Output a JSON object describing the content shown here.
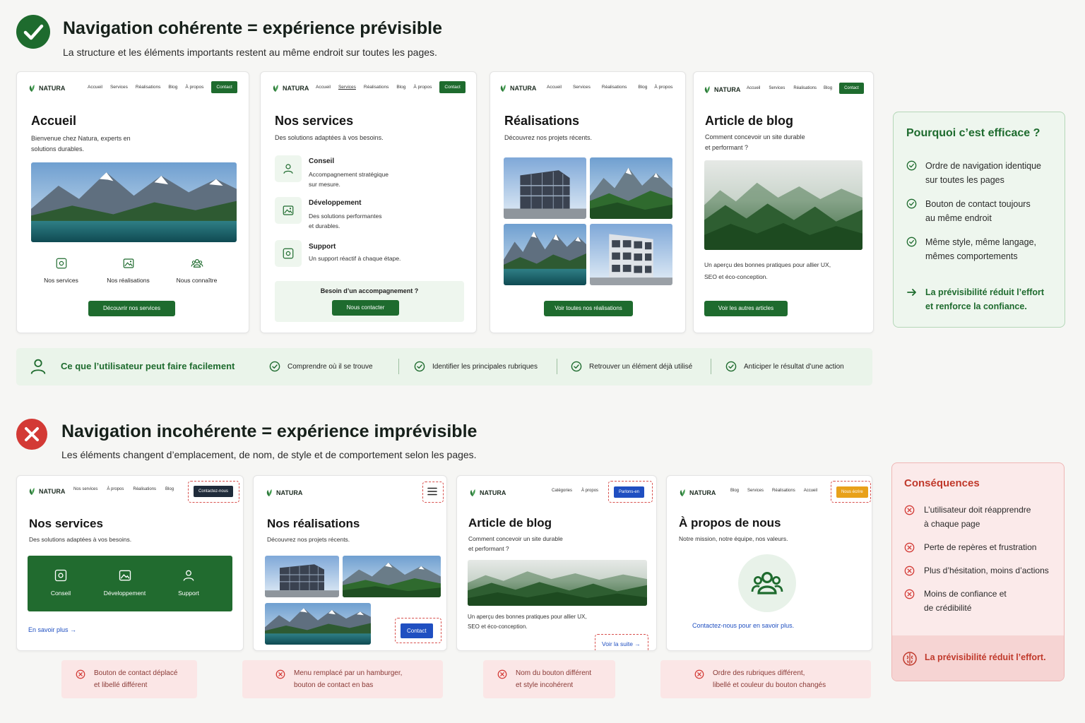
{
  "colors": {
    "green": "#1e6b2e",
    "red": "#d33a35",
    "panel_green": "#eef6ee",
    "panel_red": "#fbe9e9",
    "blue": "#1f4fc1",
    "orange": "#e8a11a",
    "navy": "#1f2b3a"
  },
  "good": {
    "title": "Navigation cohérente = expérience prévisible",
    "subtitle": "La structure et les éléments importants restent au même endroit sur toutes les pages.",
    "cards": [
      {
        "logo": "NATURA",
        "nav": [
          "Accueil",
          "Services",
          "Réalisations",
          "Blog",
          "À propos"
        ],
        "contact": "Contact",
        "heading": "Accueil",
        "desc": [
          "Bienvenue chez Natura, experts en",
          "solutions durables."
        ],
        "icons": [
          {
            "icon": "services-icon",
            "label": "Nos services"
          },
          {
            "icon": "projects-icon",
            "label": "Nos réalisations"
          },
          {
            "icon": "team-icon",
            "label": "Nous connaître"
          }
        ],
        "cta": "Découvrir nos services"
      },
      {
        "logo": "NATURA",
        "nav": [
          "Accueil",
          "Services",
          "Réalisations",
          "Blog",
          "À propos"
        ],
        "contact": "Contact",
        "heading": "Nos services",
        "desc": [
          "Des solutions adaptées à vos besoins."
        ],
        "services": [
          {
            "icon": "advice-icon",
            "title": "Conseil",
            "desc": [
              "Accompagnement stratégique",
              "sur mesure."
            ]
          },
          {
            "icon": "development-icon",
            "title": "Développement",
            "desc": [
              "Des solutions performantes",
              "et durables."
            ]
          },
          {
            "icon": "support-icon",
            "title": "Support",
            "desc": [
              "Un support réactif à chaque étape."
            ]
          }
        ],
        "box_title": "Besoin d’un accompagnement ?",
        "cta": "Nous contacter"
      },
      {
        "logo": "NATURA",
        "nav": [
          "Accueil",
          "Services",
          "Réalisations",
          "Blog",
          "À propos"
        ],
        "heading": "Réalisations",
        "desc": [
          "Découvrez nos projets récents."
        ],
        "cta": "Voir toutes nos réalisations"
      },
      {
        "logo": "NATURA",
        "nav": [
          "Accueil",
          "Services",
          "Réalisations",
          "Blog"
        ],
        "contact": "Contact",
        "heading": "Article de blog",
        "desc": [
          "Comment concevoir un site durable",
          "et performant ?"
        ],
        "excerpt": [
          "Un aperçu des bonnes pratiques pour allier UX,",
          "SEO et éco-conception."
        ],
        "cta": "Voir les autres articles"
      }
    ],
    "why": {
      "title": "Pourquoi c’est efficace ?",
      "items": [
        [
          "Ordre de navigation identique",
          "sur toutes les pages"
        ],
        [
          "Bouton de contact toujours",
          "au même endroit"
        ],
        [
          "Même style, même langage,",
          "mêmes comportements"
        ]
      ],
      "conclusion": [
        "La prévisibilité réduit l’effort",
        "et renforce la confiance."
      ]
    },
    "bar": {
      "title": "Ce que l’utilisateur peut faire facilement",
      "items": [
        "Comprendre où il se trouve",
        "Identifier les principales rubriques",
        "Retrouver un élément déjà utilisé",
        "Anticiper le résultat d’une action"
      ]
    }
  },
  "bad": {
    "title": "Navigation incohérente = expérience imprévisible",
    "subtitle": "Les éléments changent d’emplacement, de nom, de style et de comportement selon les pages.",
    "cards": [
      {
        "logo": "NATURA",
        "nav": [
          "Nos services",
          "À propos",
          "Réalisations",
          "Blog"
        ],
        "contact": "Contactez-nous",
        "heading": "Nos services",
        "desc": [
          "Des solutions adaptées à vos besoins."
        ],
        "tiles": [
          "Conseil",
          "Développement",
          "Support"
        ],
        "link": "En savoir plus →"
      },
      {
        "logo": "NATURA",
        "heading": "Nos réalisations",
        "desc": [
          "Découvrez nos projets récents."
        ],
        "contact": "Contact"
      },
      {
        "logo": "NATURA",
        "nav": [
          "Catégories",
          "À propos"
        ],
        "contact": "Parlons-en",
        "heading": "Article de blog",
        "desc": [
          "Comment concevoir un site durable",
          "et performant ?"
        ],
        "excerpt": [
          "Un aperçu des bonnes pratiques pour allier UX,",
          "SEO et éco-conception."
        ],
        "link": "Voir la suite →"
      },
      {
        "logo": "NATURA",
        "nav": [
          "Blog",
          "Services",
          "Réalisations",
          "Accueil"
        ],
        "contact": "Nous écrire",
        "heading": "À propos de nous",
        "desc": [
          "Notre mission, notre équipe, nos valeurs."
        ],
        "link": "Contactez-nous pour en savoir plus."
      }
    ],
    "notes": [
      [
        "Bouton de contact déplacé",
        "et libellé différent"
      ],
      [
        "Menu remplacé par un hamburger,",
        "bouton de contact en bas"
      ],
      [
        "Nom du bouton différent",
        "et style incohérent"
      ],
      [
        "Ordre des rubriques différent,",
        "libellé et couleur du bouton changés"
      ]
    ],
    "consequences": {
      "title": "Conséquences",
      "items": [
        [
          "L’utilisateur doit réapprendre",
          "à chaque page"
        ],
        [
          "Perte de repères et frustration"
        ],
        [
          "Plus d’hésitation, moins d’actions"
        ],
        [
          "Moins de confiance et",
          "de crédibilité"
        ]
      ],
      "conclusion": "La prévisibilité réduit l’effort."
    }
  }
}
